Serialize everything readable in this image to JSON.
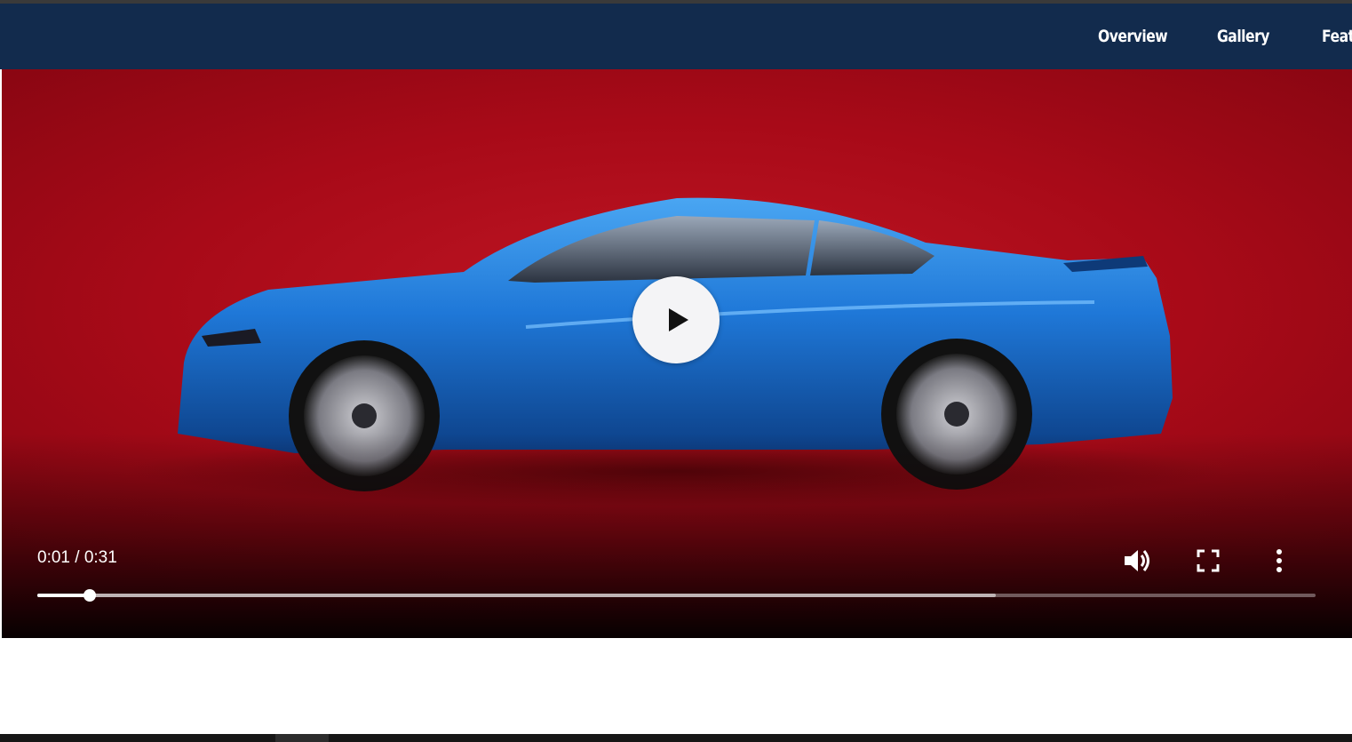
{
  "nav": {
    "items": [
      {
        "label": "Overview"
      },
      {
        "label": "Gallery"
      },
      {
        "label": "Feat"
      }
    ]
  },
  "video": {
    "current_time": "0:01",
    "duration": "0:31",
    "time_display": "0:01 / 0:31",
    "played_fraction": 0.041,
    "buffered_fraction": 0.75,
    "controls": {
      "play_icon": "play-icon",
      "volume_icon": "volume-icon",
      "fullscreen_icon": "fullscreen-icon",
      "more_icon": "more-vertical-icon"
    }
  },
  "colors": {
    "nav_background": "#122b4d",
    "video_backdrop": "#b00e1c",
    "car_body": "#1a73d6"
  }
}
